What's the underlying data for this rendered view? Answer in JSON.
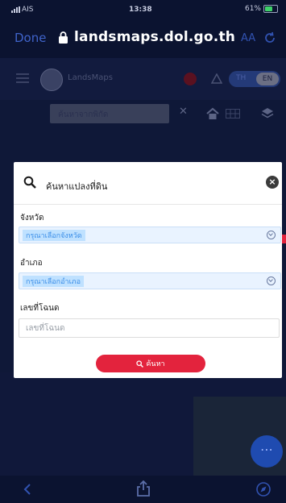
{
  "status_bar": {
    "carrier": "AIS",
    "time": "13:38",
    "battery": "61%"
  },
  "browser": {
    "done_label": "Done",
    "url": "landsmaps.dol.go.th",
    "text_size_label": "AA"
  },
  "app_header": {
    "brand": "LandsMaps",
    "lang_th": "TH",
    "lang_en": "EN"
  },
  "toolbar": {
    "search_placeholder": "ค้นหาจากพิกัด"
  },
  "modal": {
    "title": "ค้นหาแปลงที่ดิน",
    "province_label": "จังหวัด",
    "province_value": "กรุณาเลือกจังหวัด",
    "district_label": "อำเภอ",
    "district_value": "กรุณาเลือกอำเภอ",
    "parcel_label": "เลขที่โฉนด",
    "parcel_placeholder": "เลขที่โฉนด",
    "search_button_label": "ค้นหา"
  },
  "colors": {
    "accent_red": "#e3233d",
    "select_blue": "#3b8ee8",
    "browser_blue": "#3f63c9"
  },
  "icons": [
    "lock-icon",
    "reload-icon",
    "menu-icon",
    "home-icon",
    "grid-icon",
    "layers-icon",
    "search-icon",
    "close-icon",
    "chevron-down-icon",
    "back-icon",
    "share-icon",
    "compass-icon"
  ]
}
